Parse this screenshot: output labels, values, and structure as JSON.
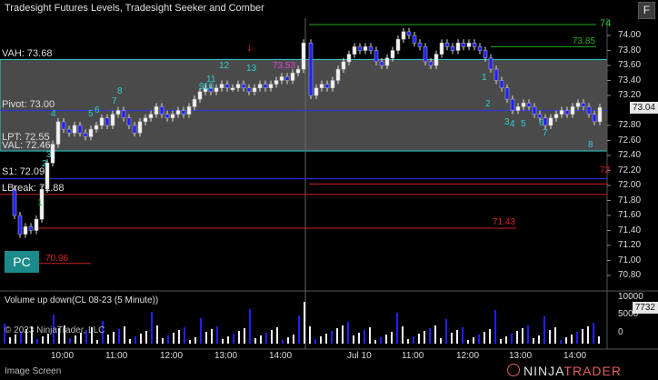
{
  "header": {
    "title": "Tradesight Futures Levels, Tradesight Seeker and Comber"
  },
  "top_right_button": {
    "label": "F"
  },
  "pc_button": {
    "label": "PC"
  },
  "levels": {
    "vah": "VAH: 73.68",
    "pivot": "Pivot: 73.00",
    "lpt": "LPT: 72.55",
    "val": "VAL: 72.46",
    "s1": "S1: 72.09",
    "lbreak": "LBreak: 71.88",
    "r_partial": "74",
    "green_right": "73.85",
    "red_right": "72",
    "red_mid": "71.43",
    "red_low": "70.96"
  },
  "signals": {
    "cyan_up": [
      "12",
      "13",
      "9",
      "10",
      "11",
      "8",
      "7",
      "6",
      "5",
      "4",
      "3",
      "2",
      "1"
    ],
    "magenta": "73.53",
    "right_seq": [
      "1",
      "2",
      "3",
      "4",
      "5",
      "6",
      "7",
      "8"
    ]
  },
  "price_axis": {
    "ticks": [
      "74.00",
      "73.80",
      "73.60",
      "73.40",
      "73.20",
      "72.80",
      "72.60",
      "72.40",
      "72.20",
      "72.00",
      "71.80",
      "71.60",
      "71.40",
      "71.20",
      "71.00",
      "70.80"
    ],
    "last_price": "73.04"
  },
  "volume": {
    "title": "Volume up down(CL 08-23 (5 Minute))",
    "ticks": [
      "10000",
      "5000",
      "0"
    ],
    "last_value": "7732"
  },
  "time_axis": {
    "labels": [
      "10:00",
      "11:00",
      "12:00",
      "13:00",
      "14:00",
      "Jul 10",
      "11:00",
      "12:00",
      "13:00",
      "14:00"
    ]
  },
  "footer": {
    "copyright": "© 2023 NinjaTrader, LLC",
    "status": "Image Screen",
    "logo_left": "NINJA",
    "logo_right": "TRADER"
  },
  "colors": {
    "band": "#4a4a4a",
    "band_border": "#2fd0d0",
    "green_line": "#22aa22",
    "blue_line": "#3030ff",
    "red_line": "#cc2020",
    "down_candle": "#2020ff",
    "cyan_text": "#2fd0d0",
    "magenta_text": "#e040e0"
  }
}
